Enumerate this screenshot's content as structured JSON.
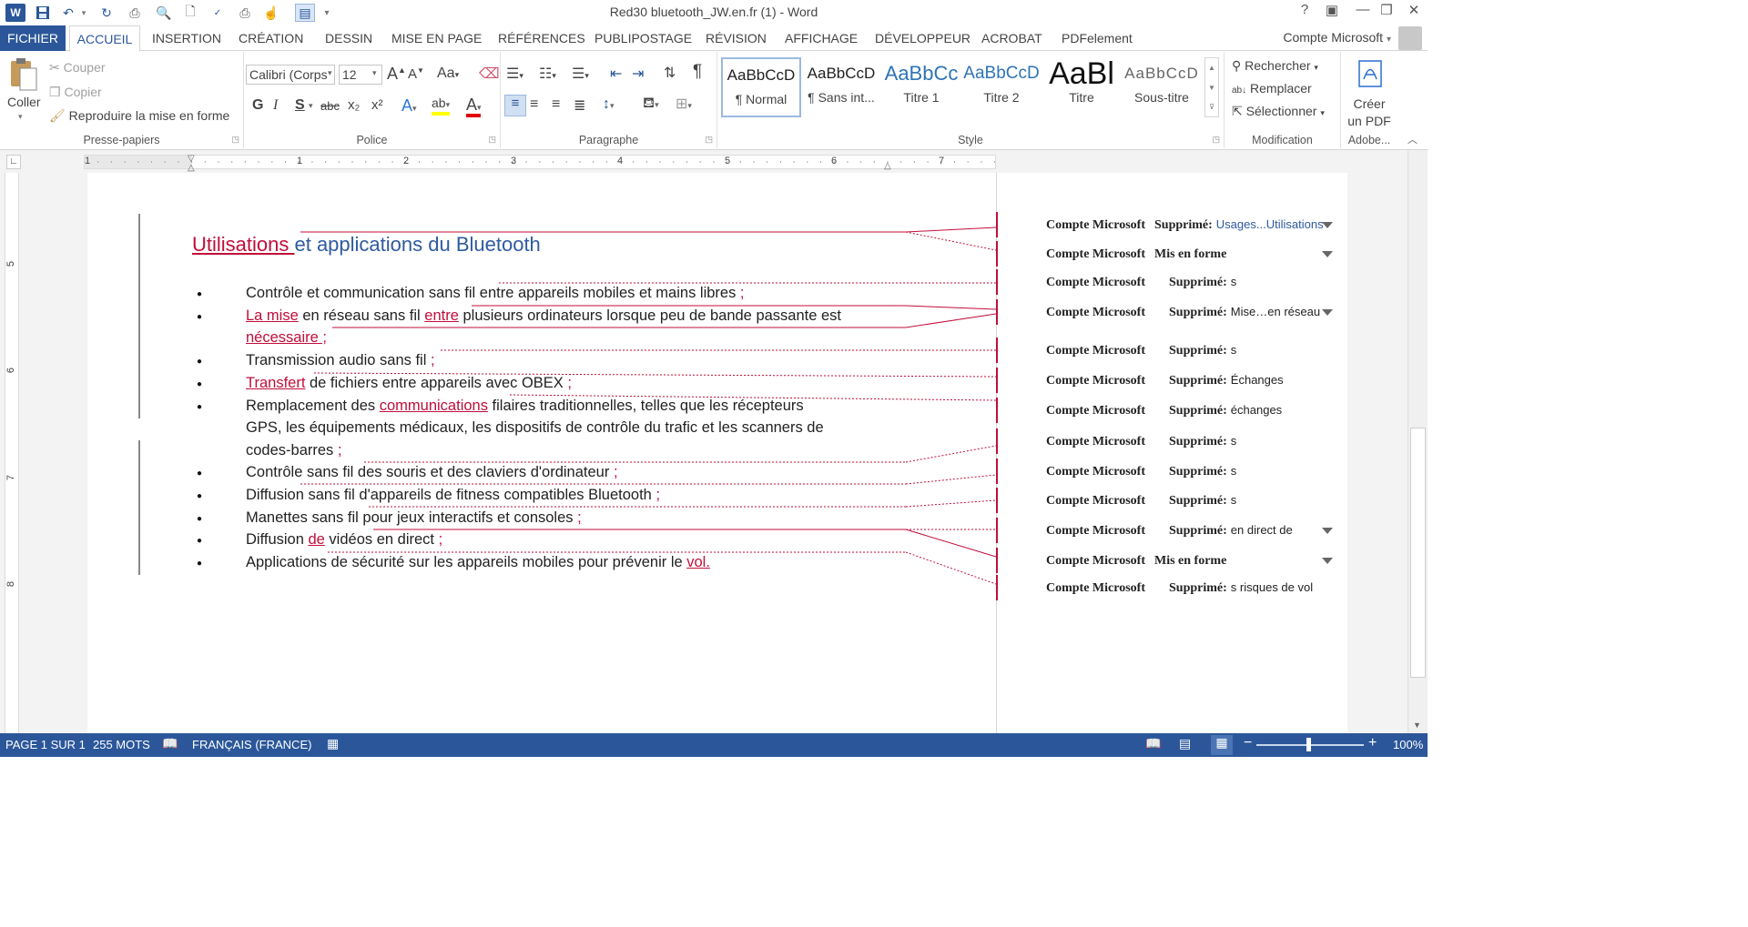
{
  "window": {
    "title": "Red30 bluetooth_JW.en.fr (1) - Word",
    "controls": [
      "?",
      "▣",
      "—",
      "❐",
      "✕"
    ]
  },
  "quick_access": {
    "icons": [
      "word-logo-icon",
      "save-icon",
      "undo-icon",
      "redo-icon",
      "print-preview-icon",
      "quick-print-icon",
      "new-document-icon",
      "spelling-icon",
      "print-icon",
      "touch-mode-icon",
      "document-view-icon",
      "customize-icon"
    ]
  },
  "tabs": [
    "FICHIER",
    "ACCUEIL",
    "INSERTION",
    "CRÉATION",
    "DESSIN",
    "MISE EN PAGE",
    "RÉFÉRENCES",
    "PUBLIPOSTAGE",
    "RÉVISION",
    "AFFICHAGE",
    "DÉVELOPPEUR",
    "ACROBAT",
    "PDFelement"
  ],
  "active_tab": "ACCUEIL",
  "account": "Compte Microsoft",
  "ribbon": {
    "clipboard": {
      "paste": "Coller",
      "cut": "Couper",
      "copy": "Copier",
      "format_painter": "Reproduire la mise en forme",
      "label": "Presse-papiers"
    },
    "font": {
      "name": "Calibri (Corps",
      "size": "12",
      "label": "Police",
      "bold": "G",
      "italic": "I",
      "underline": "S",
      "strike": "abc",
      "sub": "x₂",
      "sup": "x²",
      "case": "Aa"
    },
    "paragraph": {
      "label": "Paragraphe"
    },
    "styles": {
      "label": "Style",
      "items": [
        {
          "preview": "AaBbCcD",
          "name": "¶ Normal"
        },
        {
          "preview": "AaBbCcD",
          "name": "¶ Sans int..."
        },
        {
          "preview": "AaBbCc",
          "name": "Titre 1"
        },
        {
          "preview": "AaBbCcD",
          "name": "Titre 2"
        },
        {
          "preview": "AaBl",
          "name": "Titre"
        },
        {
          "preview": "AaBbCcD",
          "name": "Sous-titre"
        }
      ]
    },
    "editing": {
      "find": "Rechercher",
      "replace": "Remplacer",
      "select": "Sélectionner",
      "label": "Modification"
    },
    "adobe": {
      "create_l1": "Créer",
      "create_l2": "un PDF",
      "label": "Adobe..."
    }
  },
  "ruler": {
    "h_numbers": [
      "1",
      "1",
      "2",
      "3",
      "4",
      "5",
      "6",
      "7"
    ],
    "v_numbers": [
      "5",
      "6",
      "7",
      "8"
    ]
  },
  "document": {
    "heading_inserted": "Utilisations ",
    "heading_rest": " et applications du Bluetooth",
    "bullets": [
      {
        "lines": [
          [
            {
              "t": "Contrôle et communication sans fil entre appareils mobiles et mains libres "
            },
            {
              "t": ";",
              "ins": true
            }
          ]
        ]
      },
      {
        "lines": [
          [
            {
              "t": "La mise",
              "ins": true
            },
            {
              "t": " en réseau sans fil "
            },
            {
              "t": "entre",
              "ins": true
            },
            {
              "t": " plusieurs ordinateurs lorsque peu de bande passante est"
            }
          ],
          [
            {
              "t": "nécessaire ;",
              "ins": true
            }
          ]
        ]
      },
      {
        "lines": [
          [
            {
              "t": "Transmission audio sans fil "
            },
            {
              "t": ";",
              "ins": true
            }
          ]
        ]
      },
      {
        "lines": [
          [
            {
              "t": "Transfert",
              "ins": true
            },
            {
              "t": " de fichiers entre appareils avec OBEX "
            },
            {
              "t": ";",
              "ins": true
            }
          ]
        ]
      },
      {
        "lines": [
          [
            {
              "t": "Remplacement des "
            },
            {
              "t": "communications",
              "ins": true
            },
            {
              "t": " filaires traditionnelles, telles que les récepteurs"
            }
          ],
          [
            {
              "t": "GPS, les équipements médicaux, les dispositifs de contrôle du trafic et les scanners de"
            }
          ],
          [
            {
              "t": "codes-barres "
            },
            {
              "t": ";",
              "ins": true
            }
          ]
        ]
      },
      {
        "lines": [
          [
            {
              "t": "Contrôle sans fil des souris et des claviers d'ordinateur "
            },
            {
              "t": ";",
              "ins": true
            }
          ]
        ]
      },
      {
        "lines": [
          [
            {
              "t": "Diffusion sans fil d'appareils de fitness compatibles Bluetooth "
            },
            {
              "t": ";",
              "ins": true
            }
          ]
        ]
      },
      {
        "lines": [
          [
            {
              "t": "Manettes sans fil pour jeux interactifs et consoles "
            },
            {
              "t": ";",
              "ins": true
            }
          ]
        ]
      },
      {
        "lines": [
          [
            {
              "t": "Diffusion "
            },
            {
              "t": "de",
              "ins": true
            },
            {
              "t": " vidéos en direct "
            },
            {
              "t": ";",
              "ins": true
            }
          ]
        ]
      },
      {
        "lines": [
          [
            {
              "t": "Applications de sécurité sur les appareils mobiles pour prévenir le "
            },
            {
              "t": "vol.",
              "ins": true
            }
          ]
        ]
      }
    ]
  },
  "comments": [
    {
      "author": "Compte Microsoft",
      "action": "Supprimé:",
      "text": "Usages...Utilisations",
      "blue": true,
      "dropdown": true
    },
    {
      "author": "Compte Microsoft",
      "action": "Mis en forme",
      "text": "",
      "dropdown": true
    },
    {
      "author": "Compte Microsoft",
      "action": "Supprimé:",
      "text": "s"
    },
    {
      "author": "Compte Microsoft",
      "action": "Supprimé:",
      "text": "Mise…en réseau",
      "dropdown": true
    },
    {
      "author": "Compte Microsoft",
      "action": "Supprimé:",
      "text": "s"
    },
    {
      "author": "Compte Microsoft",
      "action": "Supprimé:",
      "text": "Échanges"
    },
    {
      "author": "Compte Microsoft",
      "action": "Supprimé:",
      "text": "échanges"
    },
    {
      "author": "Compte Microsoft",
      "action": "Supprimé:",
      "text": "s"
    },
    {
      "author": "Compte Microsoft",
      "action": "Supprimé:",
      "text": "s"
    },
    {
      "author": "Compte Microsoft",
      "action": "Supprimé:",
      "text": "s"
    },
    {
      "author": "Compte Microsoft",
      "action": "Supprimé:",
      "text": "en direct de",
      "dropdown": true
    },
    {
      "author": "Compte Microsoft",
      "action": "Mis en forme",
      "text": "",
      "dropdown": true
    },
    {
      "author": "Compte Microsoft",
      "action": "Supprimé:",
      "text": "s risques de vol"
    }
  ],
  "statusbar": {
    "page": "PAGE 1 SUR 1",
    "words": "255 MOTS",
    "language": "FRANÇAIS (FRANCE)",
    "zoom": "100%"
  },
  "colors": {
    "accent": "#2b579a",
    "revision": "#c10e3a",
    "heading": "#2e5aa0"
  }
}
